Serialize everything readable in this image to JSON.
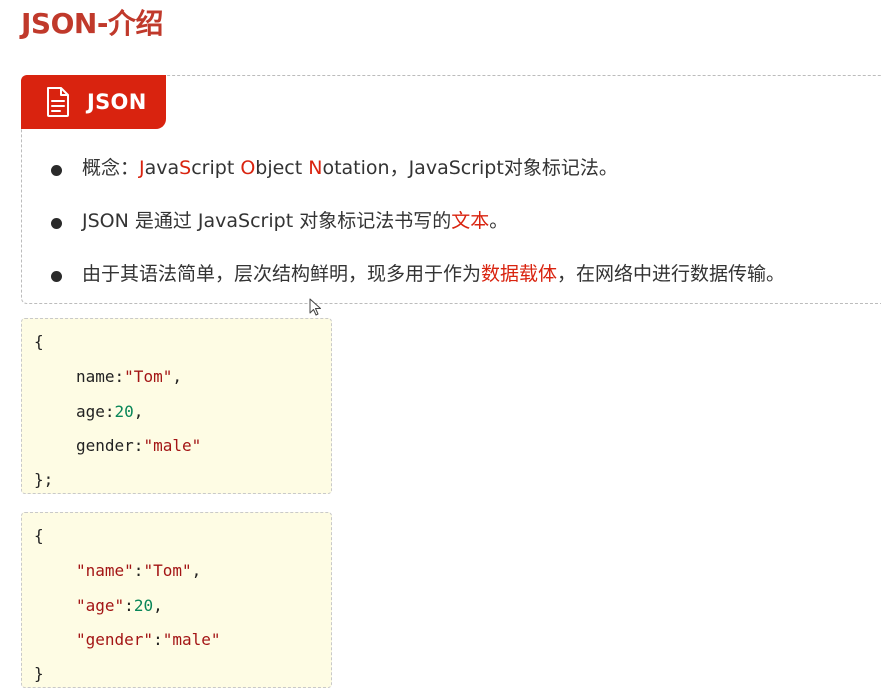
{
  "page": {
    "title": "JSON-介绍"
  },
  "card": {
    "tab_label": "JSON",
    "tab_icon": "document-icon",
    "accent_color": "#d9230f",
    "bullets": [
      {
        "segments": [
          {
            "text": "概念：",
            "highlight": false
          },
          {
            "text": "J",
            "highlight": true
          },
          {
            "text": "ava",
            "highlight": false
          },
          {
            "text": "S",
            "highlight": true
          },
          {
            "text": "cript ",
            "highlight": false
          },
          {
            "text": "O",
            "highlight": true
          },
          {
            "text": "bject ",
            "highlight": false
          },
          {
            "text": "N",
            "highlight": true
          },
          {
            "text": "otation，JavaScript对象标记法。",
            "highlight": false
          }
        ]
      },
      {
        "segments": [
          {
            "text": "JSON 是通过 JavaScript 对象标记法书写的",
            "highlight": false
          },
          {
            "text": "文本",
            "highlight": true
          },
          {
            "text": "。",
            "highlight": false
          }
        ]
      },
      {
        "segments": [
          {
            "text": "由于其语法简单，层次结构鲜明，现多用于作为",
            "highlight": false
          },
          {
            "text": "数据载体",
            "highlight": true
          },
          {
            "text": "，在网络中进行数据传输。",
            "highlight": false
          }
        ]
      }
    ]
  },
  "code_examples": [
    {
      "lines": [
        {
          "indent": false,
          "tokens": [
            {
              "t": "{",
              "k": "p"
            }
          ]
        },
        {
          "indent": true,
          "tokens": [
            {
              "t": "name:",
              "k": "p"
            },
            {
              "t": "\"Tom\"",
              "k": "s"
            },
            {
              "t": ",",
              "k": "p"
            }
          ]
        },
        {
          "indent": true,
          "tokens": [
            {
              "t": "age:",
              "k": "p"
            },
            {
              "t": "20",
              "k": "n"
            },
            {
              "t": ",",
              "k": "p"
            }
          ]
        },
        {
          "indent": true,
          "tokens": [
            {
              "t": "gender:",
              "k": "p"
            },
            {
              "t": "\"male\"",
              "k": "s"
            }
          ]
        },
        {
          "indent": false,
          "tokens": [
            {
              "t": "};",
              "k": "p"
            }
          ]
        }
      ]
    },
    {
      "lines": [
        {
          "indent": false,
          "tokens": [
            {
              "t": "{",
              "k": "p"
            }
          ]
        },
        {
          "indent": true,
          "tokens": [
            {
              "t": "\"name\"",
              "k": "s"
            },
            {
              "t": ":",
              "k": "p"
            },
            {
              "t": "\"Tom\"",
              "k": "s"
            },
            {
              "t": ",",
              "k": "p"
            }
          ]
        },
        {
          "indent": true,
          "tokens": [
            {
              "t": "\"age\"",
              "k": "s"
            },
            {
              "t": ":",
              "k": "p"
            },
            {
              "t": "20",
              "k": "n"
            },
            {
              "t": ",",
              "k": "p"
            }
          ]
        },
        {
          "indent": true,
          "tokens": [
            {
              "t": "\"gender\"",
              "k": "s"
            },
            {
              "t": ":",
              "k": "p"
            },
            {
              "t": "\"male\"",
              "k": "s"
            }
          ]
        },
        {
          "indent": false,
          "tokens": [
            {
              "t": "}",
              "k": "p"
            }
          ]
        }
      ]
    }
  ],
  "colors": {
    "title": "#c0392b",
    "highlight": "#d9230f",
    "code_string": "#a31515",
    "code_number": "#098658",
    "code_background": "#fefce4"
  }
}
